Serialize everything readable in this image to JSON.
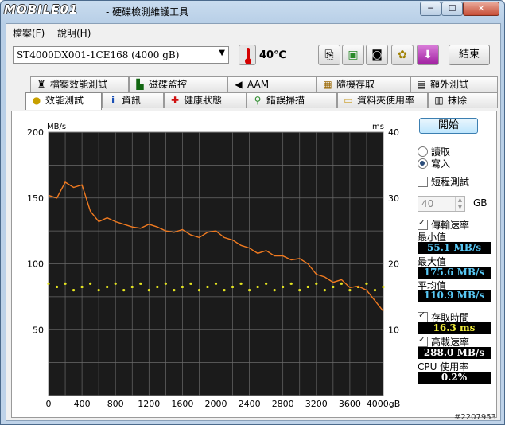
{
  "window": {
    "logo": "MOBILE01",
    "title": "- 硬碟檢測維護工具",
    "min_label": "─",
    "max_label": "☐",
    "close_label": "✕"
  },
  "menu": {
    "file": "檔案(F)",
    "help": "說明(H)"
  },
  "toolbar": {
    "drive": "ST4000DX001-1CE168 (4000 gB)",
    "temperature": "40℃",
    "exit_label": "結束",
    "tool_icons": [
      "copy-text-icon",
      "copy-image-icon",
      "screenshot-camera-icon",
      "options-icon",
      "save-download-icon"
    ]
  },
  "tabs_top": [
    {
      "label": "檔案效能測試",
      "icon": "file-benchmark-icon"
    },
    {
      "label": "磁碟監控",
      "icon": "disk-monitor-icon"
    },
    {
      "label": "AAM",
      "icon": "speaker-icon"
    },
    {
      "label": "隨機存取",
      "icon": "random-access-icon"
    },
    {
      "label": "額外測試",
      "icon": "extra-tests-icon"
    }
  ],
  "tabs_bottom": [
    {
      "label": "效能測試",
      "icon": "benchmark-bulb-icon",
      "active": true
    },
    {
      "label": "資訊",
      "icon": "info-icon",
      "active": false
    },
    {
      "label": "健康狀態",
      "icon": "health-cross-icon",
      "active": false
    },
    {
      "label": "錯誤掃描",
      "icon": "error-scan-icon",
      "active": false
    },
    {
      "label": "資料夾使用率",
      "icon": "folder-usage-icon",
      "active": false
    },
    {
      "label": "抹除",
      "icon": "erase-trash-icon",
      "active": false
    }
  ],
  "controls": {
    "start_label": "開始",
    "read_label": "讀取",
    "write_label": "寫入",
    "mode": "write",
    "short_test_label": "短程測試",
    "short_test_checked": false,
    "short_test_size": "40",
    "size_unit": "GB",
    "transfer_rate_label": "傳輸速率",
    "transfer_rate_checked": true,
    "min_label": "最小值",
    "min_value": "55.1 MB/s",
    "max_label": "最大值",
    "max_value": "175.6 MB/s",
    "avg_label": "平均值",
    "avg_value": "110.9 MB/s",
    "access_time_label": "存取時間",
    "access_time_checked": true,
    "access_time_value": "16.3 ms",
    "burst_rate_label": "高載速率",
    "burst_rate_checked": true,
    "burst_rate_value": "288.0 MB/s",
    "cpu_label": "CPU 使用率",
    "cpu_value": "0.2%"
  },
  "colors": {
    "transfer_line": "#f07a20",
    "access_points": "#e6e620",
    "plot_bg": "#1b1b1b",
    "grid": "#6a6a6a"
  },
  "chart_data": {
    "type": "line",
    "y_left_unit": "MB/s",
    "y_right_unit": "ms",
    "ylim": [
      0,
      200
    ],
    "ylim_right": [
      0,
      40
    ],
    "xlim": [
      0,
      4000
    ],
    "x_ticks": [
      "0",
      "400",
      "800",
      "1200",
      "1600",
      "2000",
      "2400",
      "2800",
      "3200",
      "3600",
      "4000gB"
    ],
    "y_ticks_left": [
      "200",
      "150",
      "100",
      "50"
    ],
    "y_ticks_right": [
      "40",
      "30",
      "20",
      "10"
    ],
    "series": [
      {
        "type": "line",
        "x": [
          0,
          100,
          200,
          300,
          400,
          500,
          600,
          700,
          800,
          900,
          1000,
          1100,
          1200,
          1300,
          1400,
          1500,
          1600,
          1700,
          1800,
          1900,
          2000,
          2100,
          2200,
          2300,
          2400,
          2500,
          2600,
          2700,
          2800,
          2900,
          3000,
          3100,
          3200,
          3300,
          3400,
          3500,
          3600,
          3700,
          3800,
          3900,
          4000
        ],
        "values": [
          152,
          150,
          162,
          158,
          160,
          140,
          132,
          135,
          132,
          130,
          128,
          127,
          130,
          128,
          125,
          124,
          126,
          122,
          120,
          124,
          125,
          120,
          118,
          114,
          112,
          108,
          110,
          106,
          106,
          103,
          104,
          100,
          92,
          90,
          86,
          88,
          82,
          83,
          80,
          72,
          64
        ]
      },
      {
        "type": "scatter",
        "x": [
          0,
          100,
          200,
          300,
          400,
          500,
          600,
          700,
          800,
          900,
          1000,
          1100,
          1200,
          1300,
          1400,
          1500,
          1600,
          1700,
          1800,
          1900,
          2000,
          2100,
          2200,
          2300,
          2400,
          2500,
          2600,
          2700,
          2800,
          2900,
          3000,
          3100,
          3200,
          3300,
          3400,
          3500,
          3600,
          3700,
          3800,
          3900,
          4000
        ],
        "values": [
          17,
          16.5,
          17,
          16,
          16.5,
          17,
          16,
          16.5,
          17,
          16,
          16.5,
          17,
          16,
          16.5,
          17,
          16,
          16.5,
          17,
          16,
          16.5,
          17,
          16,
          16.5,
          17,
          16,
          16.5,
          17,
          16,
          16.5,
          17,
          16,
          16.5,
          17,
          16,
          16.5,
          17,
          16,
          16.5,
          17,
          16,
          16.5
        ]
      }
    ]
  },
  "watermark": "#2207953"
}
